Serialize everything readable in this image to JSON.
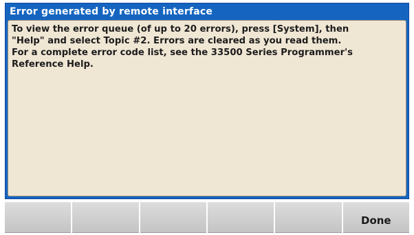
{
  "dialog": {
    "title": "Error generated by remote interface",
    "message_lines": [
      "To view the error queue (of up to 20 errors), press [System], then",
      "\"Help\" and select Topic #2. Errors are cleared as you read them.",
      "For a complete error code list, see the 33500 Series Programmer's",
      "Reference Help."
    ]
  },
  "softkeys": [
    {
      "label": ""
    },
    {
      "label": ""
    },
    {
      "label": ""
    },
    {
      "label": ""
    },
    {
      "label": ""
    },
    {
      "label": "Done"
    }
  ],
  "colors": {
    "title_bar": "#1565c0",
    "body_background": "#f0e6d4",
    "softkey_background": "#cfcfcf"
  }
}
